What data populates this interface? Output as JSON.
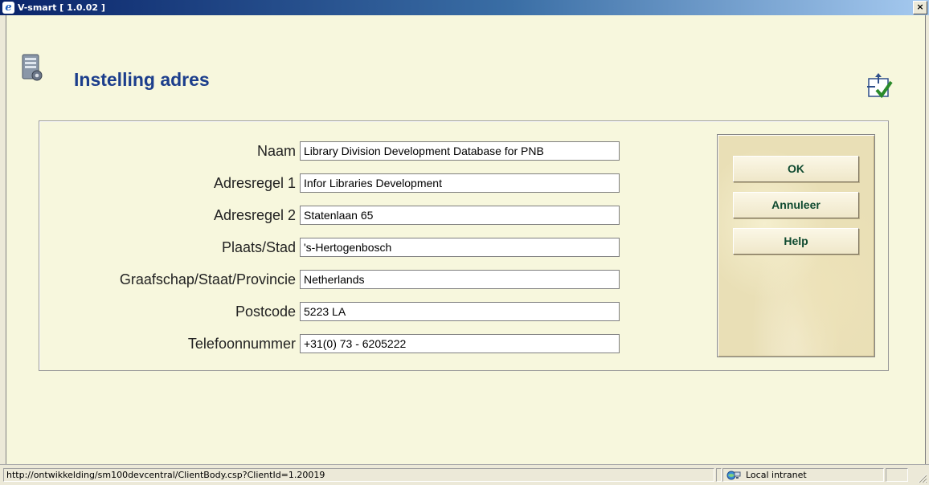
{
  "window": {
    "title": "V-smart [ 1.0.02 ]",
    "close_label": "×"
  },
  "page": {
    "title": "Instelling adres",
    "page_icon": "server-settings-icon",
    "help_icon": "help-checkmark-icon"
  },
  "form": {
    "fields": [
      {
        "label": "Naam",
        "value": "Library Division Development Database for PNB"
      },
      {
        "label": "Adresregel 1",
        "value": "Infor Libraries Development"
      },
      {
        "label": "Adresregel 2",
        "value": "Statenlaan 65"
      },
      {
        "label": "Plaats/Stad",
        "value": "'s-Hertogenbosch"
      },
      {
        "label": "Graafschap/Staat/Provincie",
        "value": "Netherlands"
      },
      {
        "label": "Postcode",
        "value": "5223 LA"
      },
      {
        "label": "Telefoonnummer",
        "value": "+31(0) 73 - 6205222"
      }
    ]
  },
  "buttons": {
    "ok": "OK",
    "cancel": "Annuleer",
    "help": "Help"
  },
  "statusbar": {
    "url": "http://ontwikkelding/sm100devcentral/ClientBody.csp?ClientId=1.20019",
    "zone": "Local intranet",
    "zone_icon": "local-intranet-icon"
  }
}
